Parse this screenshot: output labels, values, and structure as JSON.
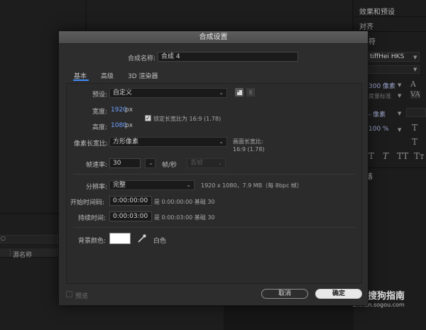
{
  "background": {
    "project_panel": {
      "column_header": "源名称"
    },
    "right_panel": {
      "effects_presets": "效果和预设",
      "align": "对齐",
      "char_partial": "符",
      "font_name": "tiffHei HKS",
      "size_value": "300 像素",
      "kerning": "度量标准",
      "leading": "- 像素",
      "scale": "100 %",
      "para_partial": "落",
      "text_style_glyphs": [
        "T",
        "T",
        "TT",
        "Tт"
      ]
    },
    "watermark": {
      "title": "搜狗指南",
      "url": "zhinan.sogou.com"
    }
  },
  "dialog": {
    "title": "合成设置",
    "comp_name_label": "合成名称:",
    "comp_name_value": "合成 4",
    "tabs": [
      {
        "label": "基本",
        "active": true
      },
      {
        "label": "高级",
        "active": false
      },
      {
        "label": "3D 渲染器",
        "active": false
      }
    ],
    "preset_label": "预设:",
    "preset_value": "自定义",
    "width_label": "宽度:",
    "width_value": "1920",
    "width_unit": "px",
    "height_label": "高度:",
    "height_value": "1080",
    "height_unit": "px",
    "lock_aspect_label": "锁定长宽比为 16:9 (1.78)",
    "lock_aspect_checked": true,
    "pixel_aspect_label": "像素长宽比:",
    "pixel_aspect_value": "方形像素",
    "frame_aspect_label": "画面长宽比:",
    "frame_aspect_value": "16:9 (1.78)",
    "frame_rate_label": "帧速率:",
    "frame_rate_value": "30",
    "frame_rate_unit": "帧/秒",
    "drop_frame_value": "丢帧",
    "resolution_label": "分辨率:",
    "resolution_value": "完整",
    "resolution_info": "1920 x 1080，7.9 MB（每 8bpc 帧）",
    "start_tc_label": "开始时间码:",
    "start_tc_value": "0:00:00:00",
    "start_tc_info": "是 0:00:00:00 基础 30",
    "duration_label": "持续时间:",
    "duration_value": "0:00:03:00",
    "duration_info": "是 0:00:03:00 基础 30",
    "bg_color_label": "背景颜色:",
    "bg_color_name": "白色",
    "bg_color_hex": "#ffffff",
    "preview_label": "预览",
    "preview_checked": false,
    "cancel_label": "取消",
    "ok_label": "确定"
  },
  "colors": {
    "accent": "#3f8cff",
    "value_blue": "#6fa0ff",
    "dialog_bg": "#2d2d2d"
  }
}
